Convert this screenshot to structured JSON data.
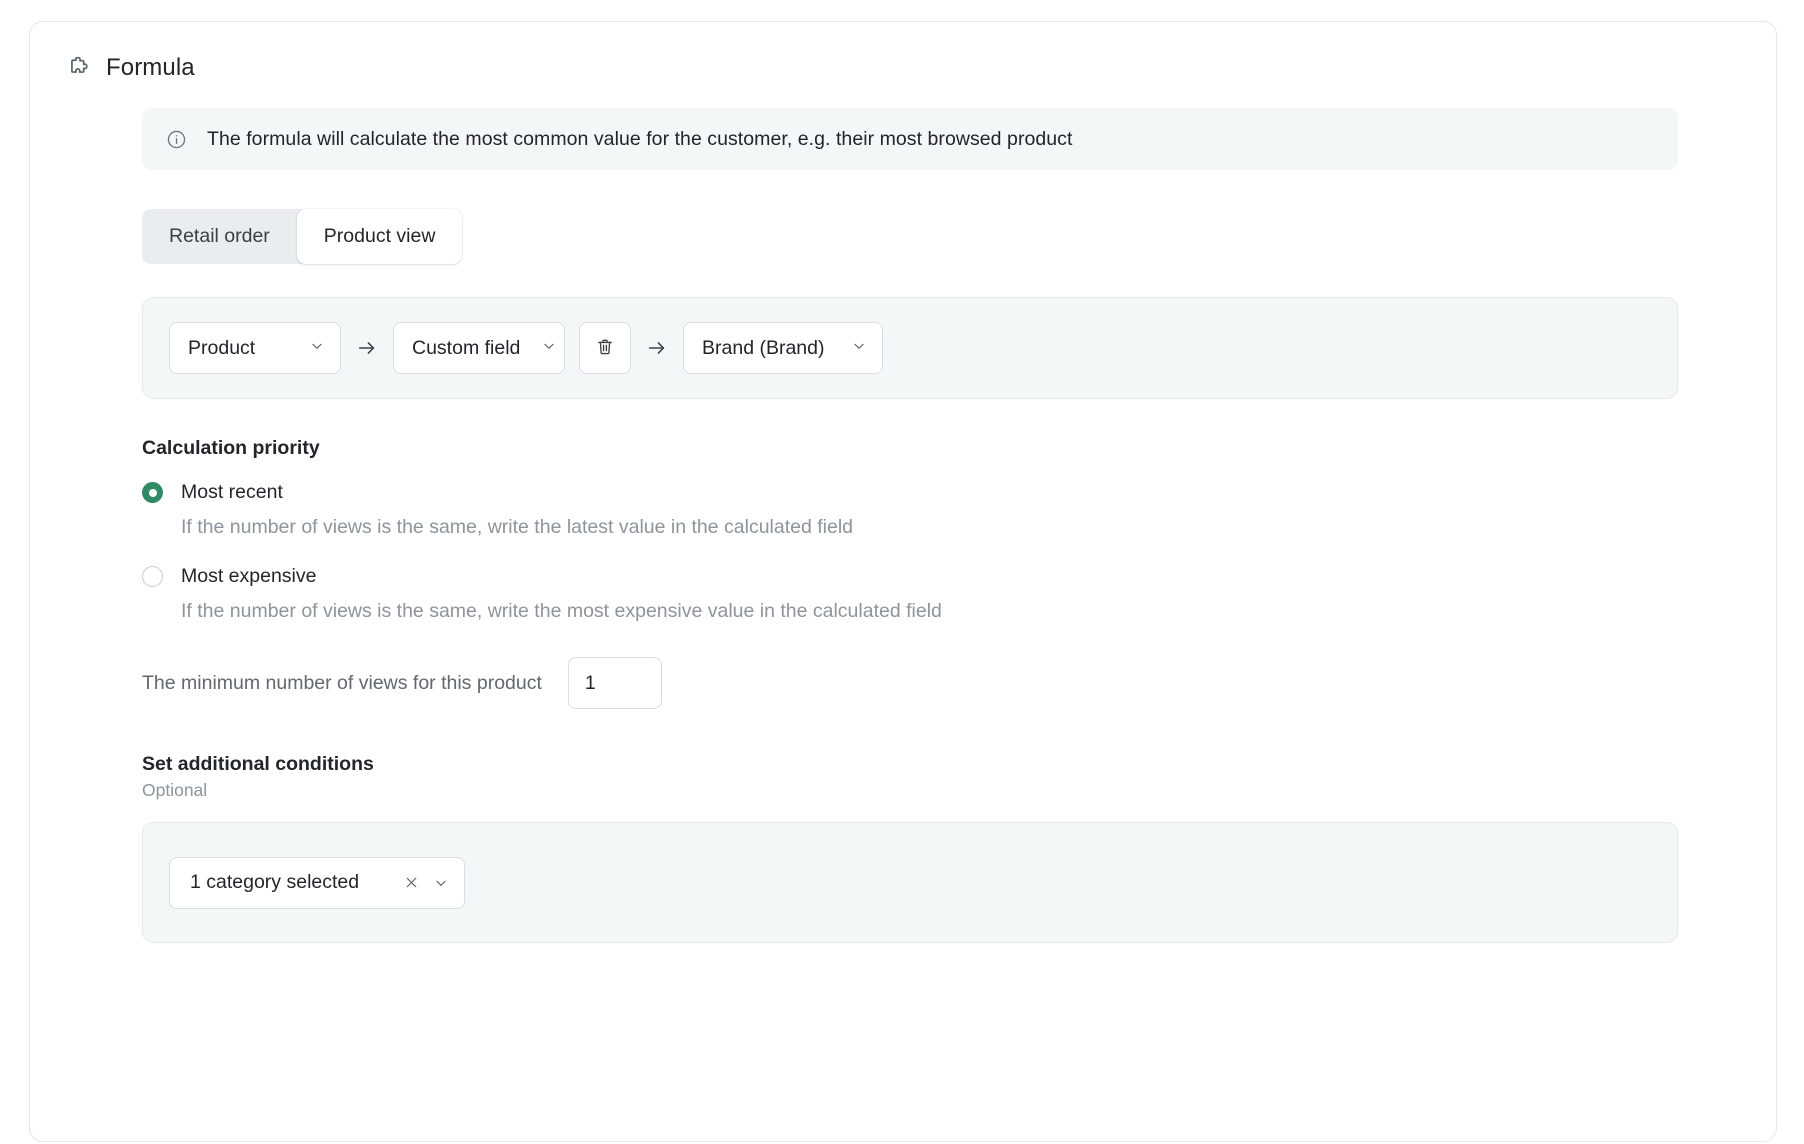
{
  "card": {
    "title": "Formula",
    "icon": "puzzle-piece-icon"
  },
  "info_banner": {
    "icon": "info-circle-icon",
    "text": "The formula will calculate the most common value for the customer, e.g. their most browsed product"
  },
  "tabs": [
    {
      "label": "Retail order",
      "active": false
    },
    {
      "label": "Product view",
      "active": true
    }
  ],
  "formula": {
    "source_select": {
      "value": "Product",
      "icon": "chevron-down-icon"
    },
    "arrow_1": "arrow-right-icon",
    "field_select": {
      "value": "Custom field",
      "icon": "chevron-down-icon"
    },
    "delete_icon": "trash-icon",
    "arrow_2": "arrow-right-icon",
    "value_select": {
      "value": "Brand (Brand)",
      "icon": "chevron-down-icon"
    }
  },
  "calculation_priority": {
    "title": "Calculation priority",
    "options": [
      {
        "label": "Most recent",
        "description": "If the number of views is the same, write the latest value in the calculated field",
        "selected": true
      },
      {
        "label": "Most expensive",
        "description": "If the number of views is the same, write the most expensive value in the calculated field",
        "selected": false
      }
    ]
  },
  "min_views": {
    "label": "The minimum number of views for this product",
    "value": "1"
  },
  "additional_conditions": {
    "title": "Set additional conditions",
    "subtitle": "Optional",
    "category_select": {
      "value": "1 category selected",
      "clear_icon": "close-icon",
      "chevron_icon": "chevron-down-icon"
    }
  },
  "colors": {
    "accent_green": "#2f8a65",
    "panel_bg": "#f4f7f8",
    "border": "#d7dee3",
    "text": "#222529",
    "muted_text": "#8d949b"
  }
}
